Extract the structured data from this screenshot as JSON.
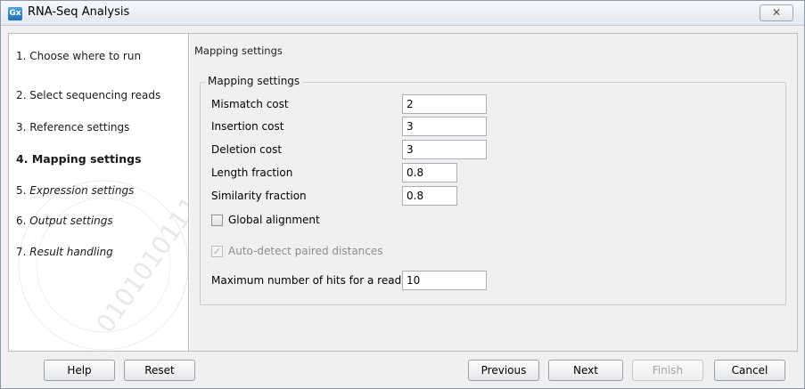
{
  "window": {
    "title": "RNA-Seq Analysis",
    "app_icon_text": "Gx",
    "close_symbol": "✕"
  },
  "steps": [
    {
      "number": "1.",
      "label": "Choose where to run",
      "style": "normal"
    },
    {
      "number": "2.",
      "label": "Select sequencing reads",
      "style": "normal"
    },
    {
      "number": "3.",
      "label": "Reference settings",
      "style": "normal"
    },
    {
      "number": "4.",
      "label": "Mapping settings",
      "style": "bold"
    },
    {
      "number": "5.",
      "label": "Expression settings",
      "style": "italic"
    },
    {
      "number": "6.",
      "label": "Output settings",
      "style": "italic"
    },
    {
      "number": "7.",
      "label": "Result handling",
      "style": "italic"
    }
  ],
  "panel": {
    "title": "Mapping settings",
    "group_title": "Mapping settings",
    "fields": {
      "mismatch_cost": {
        "label": "Mismatch cost",
        "value": "2"
      },
      "insertion_cost": {
        "label": "Insertion cost",
        "value": "3"
      },
      "deletion_cost": {
        "label": "Deletion cost",
        "value": "3"
      },
      "length_fraction": {
        "label": "Length fraction",
        "value": "0.8"
      },
      "similarity_fraction": {
        "label": "Similarity fraction",
        "value": "0.8"
      },
      "max_hits": {
        "label": "Maximum number of hits for a read",
        "value": "10"
      }
    },
    "global_alignment": {
      "label": "Global alignment",
      "checked": false
    },
    "auto_detect": {
      "label": "Auto-detect paired distances",
      "checked": true,
      "disabled": true,
      "check_symbol": "✓"
    }
  },
  "buttons": {
    "help": "Help",
    "reset": "Reset",
    "previous": "Previous",
    "next": "Next",
    "finish": "Finish",
    "cancel": "Cancel"
  },
  "watermark_text": "0101010111010"
}
